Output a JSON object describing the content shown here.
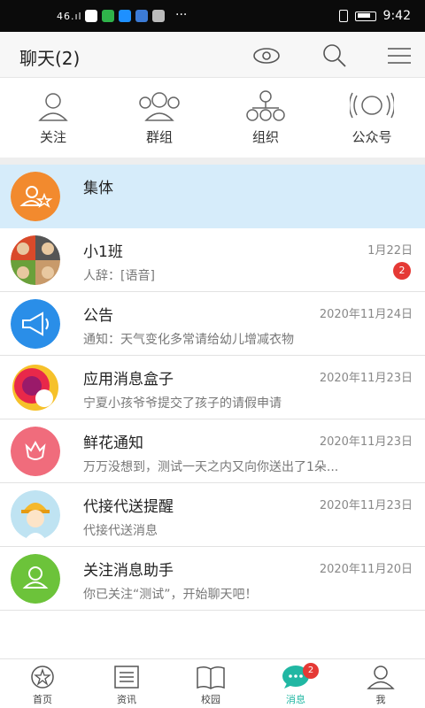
{
  "status_bar": {
    "signal": "46.ıl",
    "time": "9:42",
    "more": "···"
  },
  "header": {
    "title": "聊天(2)"
  },
  "quick_actions": [
    {
      "label": "关注",
      "icon": "person-icon"
    },
    {
      "label": "群组",
      "icon": "group-icon"
    },
    {
      "label": "组织",
      "icon": "org-icon"
    },
    {
      "label": "公众号",
      "icon": "broadcast-icon"
    }
  ],
  "chats": [
    {
      "name": "集体",
      "message": "",
      "date": "",
      "badge": "",
      "avatar_color": "#f28a2e",
      "icon": "collective-icon"
    },
    {
      "name": "小1班",
      "message": "人辞：[语音]",
      "date": "1月22日",
      "badge": "2",
      "avatar_color": "#6a8f4a",
      "icon": "class-avatar"
    },
    {
      "name": "公告",
      "message": "通知：天气变化多常请给幼儿增减衣物",
      "date": "2020年11月24日",
      "badge": "",
      "avatar_color": "#2a8ee8",
      "icon": "megaphone-icon"
    },
    {
      "name": "应用消息盒子",
      "message": "宁夏小孩爷爷提交了孩子的请假申请",
      "date": "2020年11月23日",
      "badge": "",
      "avatar_color": "#e8284a",
      "icon": "app-box-icon"
    },
    {
      "name": "鲜花通知",
      "message": "万万没想到，测试一天之内又向你送出了1朵...",
      "date": "2020年11月23日",
      "badge": "",
      "avatar_color": "#f06c7c",
      "icon": "flower-icon"
    },
    {
      "name": "代接代送提醒",
      "message": "代接代送消息",
      "date": "2020年11月23日",
      "badge": "",
      "avatar_color": "#bfe3f2",
      "icon": "worker-avatar"
    },
    {
      "name": "关注消息助手",
      "message": "你已关注“测试”，开始聊天吧！",
      "date": "2020年11月20日",
      "badge": "",
      "avatar_color": "#6cc33a",
      "icon": "follow-assistant-icon"
    }
  ],
  "tabs": [
    {
      "label": "首页",
      "icon": "star-home-icon",
      "badge": ""
    },
    {
      "label": "资讯",
      "icon": "news-list-icon",
      "badge": ""
    },
    {
      "label": "校园",
      "icon": "book-icon",
      "badge": ""
    },
    {
      "label": "消息",
      "icon": "chat-bubble-icon",
      "badge": "2",
      "active": true
    },
    {
      "label": "我",
      "icon": "profile-icon",
      "badge": ""
    }
  ],
  "colors": {
    "accent": "#21b7a3",
    "badge": "#e53935",
    "highlight_row": "#d6ecfa"
  }
}
